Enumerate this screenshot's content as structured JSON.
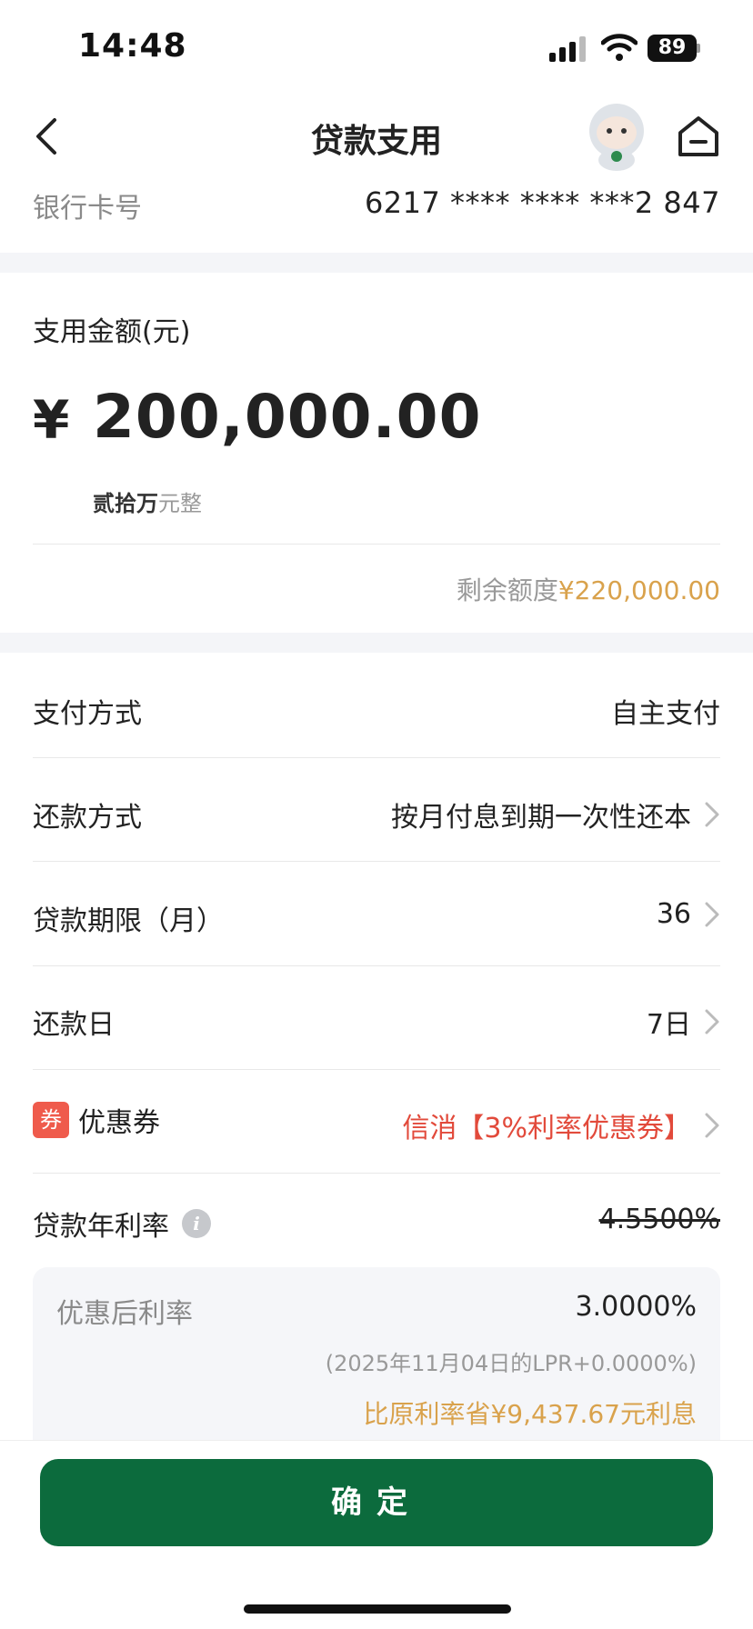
{
  "status_bar": {
    "time": "14:48",
    "battery": "89"
  },
  "nav": {
    "title": "贷款支用"
  },
  "card": {
    "label": "银行卡号",
    "value": "6217 **** **** ***2 847"
  },
  "amount": {
    "label": "支用金额(元)",
    "currency": "¥",
    "value": "200,000.00",
    "words_bold": "贰拾万",
    "words_suffix": "元整"
  },
  "remaining": {
    "label": "剩余额度",
    "amount": "¥220,000.00"
  },
  "rows": [
    {
      "label": "支付方式",
      "value": "自主支付"
    },
    {
      "label": "还款方式",
      "value": "按月付息到期一次性还本"
    },
    {
      "label": "贷款期限（月）",
      "value": "36"
    },
    {
      "label": "还款日",
      "value": "7日"
    },
    {
      "label": "优惠券",
      "badge": "券",
      "value": "信消【3%利率优惠券】"
    }
  ],
  "rate": {
    "label": "贷款年利率",
    "info_glyph": "i",
    "original": "4.5500%",
    "discounted_label": "优惠后利率",
    "discounted_value": "3.0000%",
    "lpr_note": "(2025年11月04日的LPR+0.0000%)",
    "savings": "比原利率省¥9,437.67元利息"
  },
  "confirm": {
    "label": "确定"
  },
  "colors": {
    "primary_green": "#0c6b3d",
    "gold": "#d9a24c",
    "coupon_red": "#e24a3b"
  },
  "icons": [
    "signal-icon",
    "wifi-icon",
    "battery-icon",
    "back-arrow-icon",
    "mascot-icon",
    "home-icon",
    "chevron-right-icon",
    "info-icon"
  ]
}
